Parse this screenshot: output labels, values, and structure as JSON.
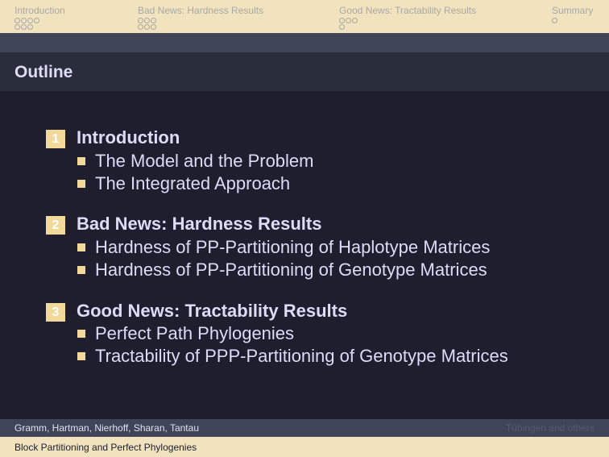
{
  "nav": {
    "sections": [
      {
        "label": "Introduction",
        "dot_rows": [
          4,
          3
        ]
      },
      {
        "label": "Bad News: Hardness Results",
        "dot_rows": [
          3,
          3
        ]
      },
      {
        "label": "Good News: Tractability Results",
        "dot_rows": [
          3,
          1
        ]
      },
      {
        "label": "Summary",
        "dot_rows": [
          1
        ]
      }
    ]
  },
  "frame": {
    "title": "Outline"
  },
  "outline": [
    {
      "number": "1",
      "title": "Introduction",
      "items": [
        "The Model and the Problem",
        "The Integrated Approach"
      ]
    },
    {
      "number": "2",
      "title": "Bad News: Hardness Results",
      "items": [
        "Hardness of PP-Partitioning of Haplotype Matrices",
        "Hardness of PP-Partitioning of Genotype Matrices"
      ]
    },
    {
      "number": "3",
      "title": "Good News: Tractability Results",
      "items": [
        "Perfect Path Phylogenies",
        "Tractability of PPP-Partitioning of Genotype Matrices"
      ]
    }
  ],
  "footer": {
    "authors": "Gramm, Hartman, Nierhoff, Sharan, Tantau",
    "institute": "Tübingen and others",
    "title": "Block Partitioning and Perfect Phylogenies"
  },
  "colors": {
    "background": "#1e1e2e",
    "header_band": "#f0e3bd",
    "accent": "#f2d99a",
    "text": "#dcdcf7"
  }
}
